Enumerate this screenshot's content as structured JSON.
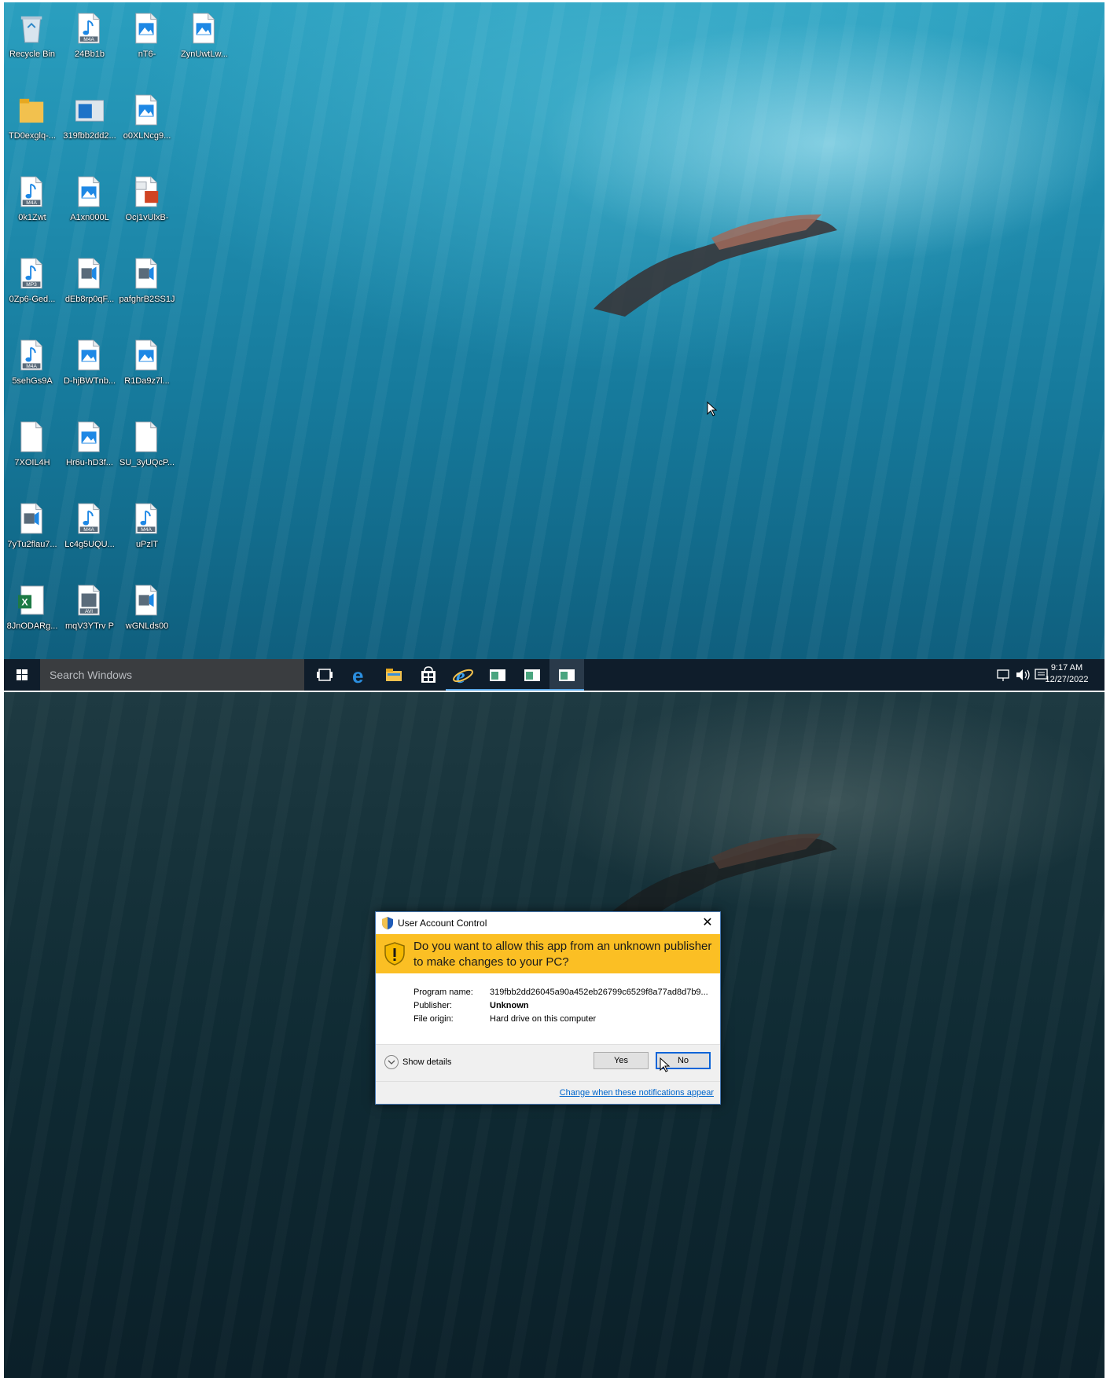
{
  "desktop": {
    "icons": [
      {
        "label": "Recycle Bin",
        "type": "recycle-bin"
      },
      {
        "label": "24Bb1b",
        "type": "m4a"
      },
      {
        "label": "nT6-",
        "type": "image"
      },
      {
        "label": "ZynUwtLw...",
        "type": "image"
      },
      {
        "label": "TD0exglq-...",
        "type": "folder"
      },
      {
        "label": "319fbb2dd2...",
        "type": "app-window"
      },
      {
        "label": "o0XLNcg9...",
        "type": "image"
      },
      {
        "label": "0k1Zwt",
        "type": "m4a"
      },
      {
        "label": "A1xn000L",
        "type": "image"
      },
      {
        "label": "Ocj1vUlxB-",
        "type": "powerpoint"
      },
      {
        "label": "0Zp6-Ged...",
        "type": "mp3"
      },
      {
        "label": "dEb8rp0qF...",
        "type": "audio"
      },
      {
        "label": "pafghrB2SS1J",
        "type": "audio"
      },
      {
        "label": "5sehGs9A",
        "type": "m4a"
      },
      {
        "label": "D-hjBWTnb...",
        "type": "image"
      },
      {
        "label": "R1Da9z7l...",
        "type": "image"
      },
      {
        "label": "7XOIL4H",
        "type": "blank"
      },
      {
        "label": "Hr6u-hD3f...",
        "type": "image"
      },
      {
        "label": "SU_3yUQcP...",
        "type": "blank"
      },
      {
        "label": "7yTu2flau7...",
        "type": "audio"
      },
      {
        "label": "Lc4g5UQU...",
        "type": "m4a"
      },
      {
        "label": "uPzlT",
        "type": "m4a"
      },
      {
        "label": "8JnODARg...",
        "type": "excel"
      },
      {
        "label": "mqV3YTrv P",
        "type": "avi"
      },
      {
        "label": "wGNLds00",
        "type": "audio"
      }
    ],
    "taskbar": {
      "search_placeholder": "Search Windows",
      "time": "9:17 AM",
      "date": "12/27/2022"
    }
  },
  "uac": {
    "title": "User Account Control",
    "question": "Do you want to allow this app from an unknown publisher to make changes to your PC?",
    "program_name_label": "Program name:",
    "program_name_value": "319fbb2dd26045a90a452eb26799c6529f8a77ad8d7b9...",
    "publisher_label": "Publisher:",
    "publisher_value": "Unknown",
    "file_origin_label": "File origin:",
    "file_origin_value": "Hard drive on this computer",
    "show_details": "Show details",
    "yes": "Yes",
    "no": "No",
    "change_link": "Change when these notifications appear",
    "banner_color": "#fbbf24"
  }
}
